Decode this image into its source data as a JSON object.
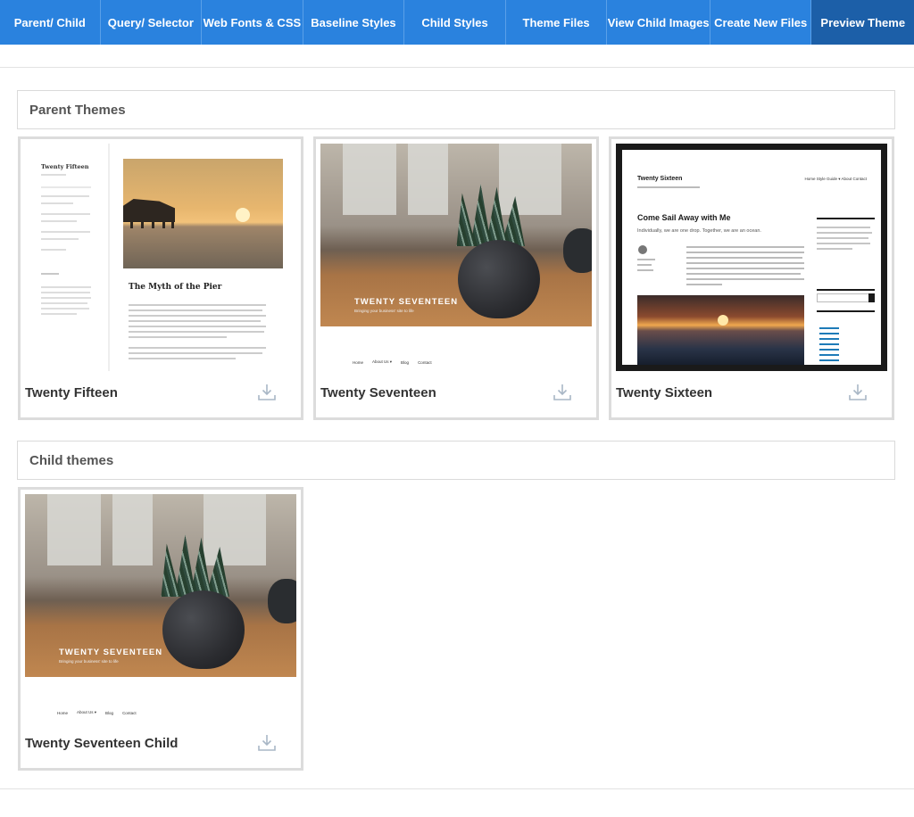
{
  "nav": {
    "tabs": [
      "Parent/ Child",
      "Query/ Selector",
      "Web Fonts & CSS",
      "Baseline Styles",
      "Child Styles",
      "Theme Files",
      "View Child Images",
      "Create New Files",
      "Preview Theme"
    ],
    "active_tab": "Preview Theme"
  },
  "sections": {
    "parent": {
      "heading": "Parent Themes",
      "themes": [
        {
          "name": "Twenty Fifteen",
          "icon": "download-icon"
        },
        {
          "name": "Twenty Seventeen",
          "icon": "download-icon"
        },
        {
          "name": "Twenty Sixteen",
          "icon": "download-icon"
        }
      ]
    },
    "child": {
      "heading": "Child themes",
      "themes": [
        {
          "name": "Twenty Seventeen Child",
          "icon": "download-icon"
        }
      ]
    }
  },
  "screenshots": {
    "fifteen": {
      "site_title": "Twenty Fifteen",
      "post_title": "The Myth of the Pier"
    },
    "seventeen": {
      "brand": "TWENTY SEVENTEEN",
      "tagline": "Bringing your business' site to life",
      "nav": [
        "Home",
        "About Us ▾",
        "Blog",
        "Contact"
      ]
    },
    "sixteen": {
      "site_title": "Twenty Sixteen",
      "nav": "Home   Style Guide ▾   About   Contact",
      "post_title": "Come Sail Away with Me",
      "excerpt": "Individually, we are one drop. Together, we are an ocean."
    }
  },
  "colors": {
    "nav_bg": "#2a82de",
    "nav_active": "#1c5fa8",
    "card_border": "#dcdcdc",
    "heading_text": "#555555"
  }
}
